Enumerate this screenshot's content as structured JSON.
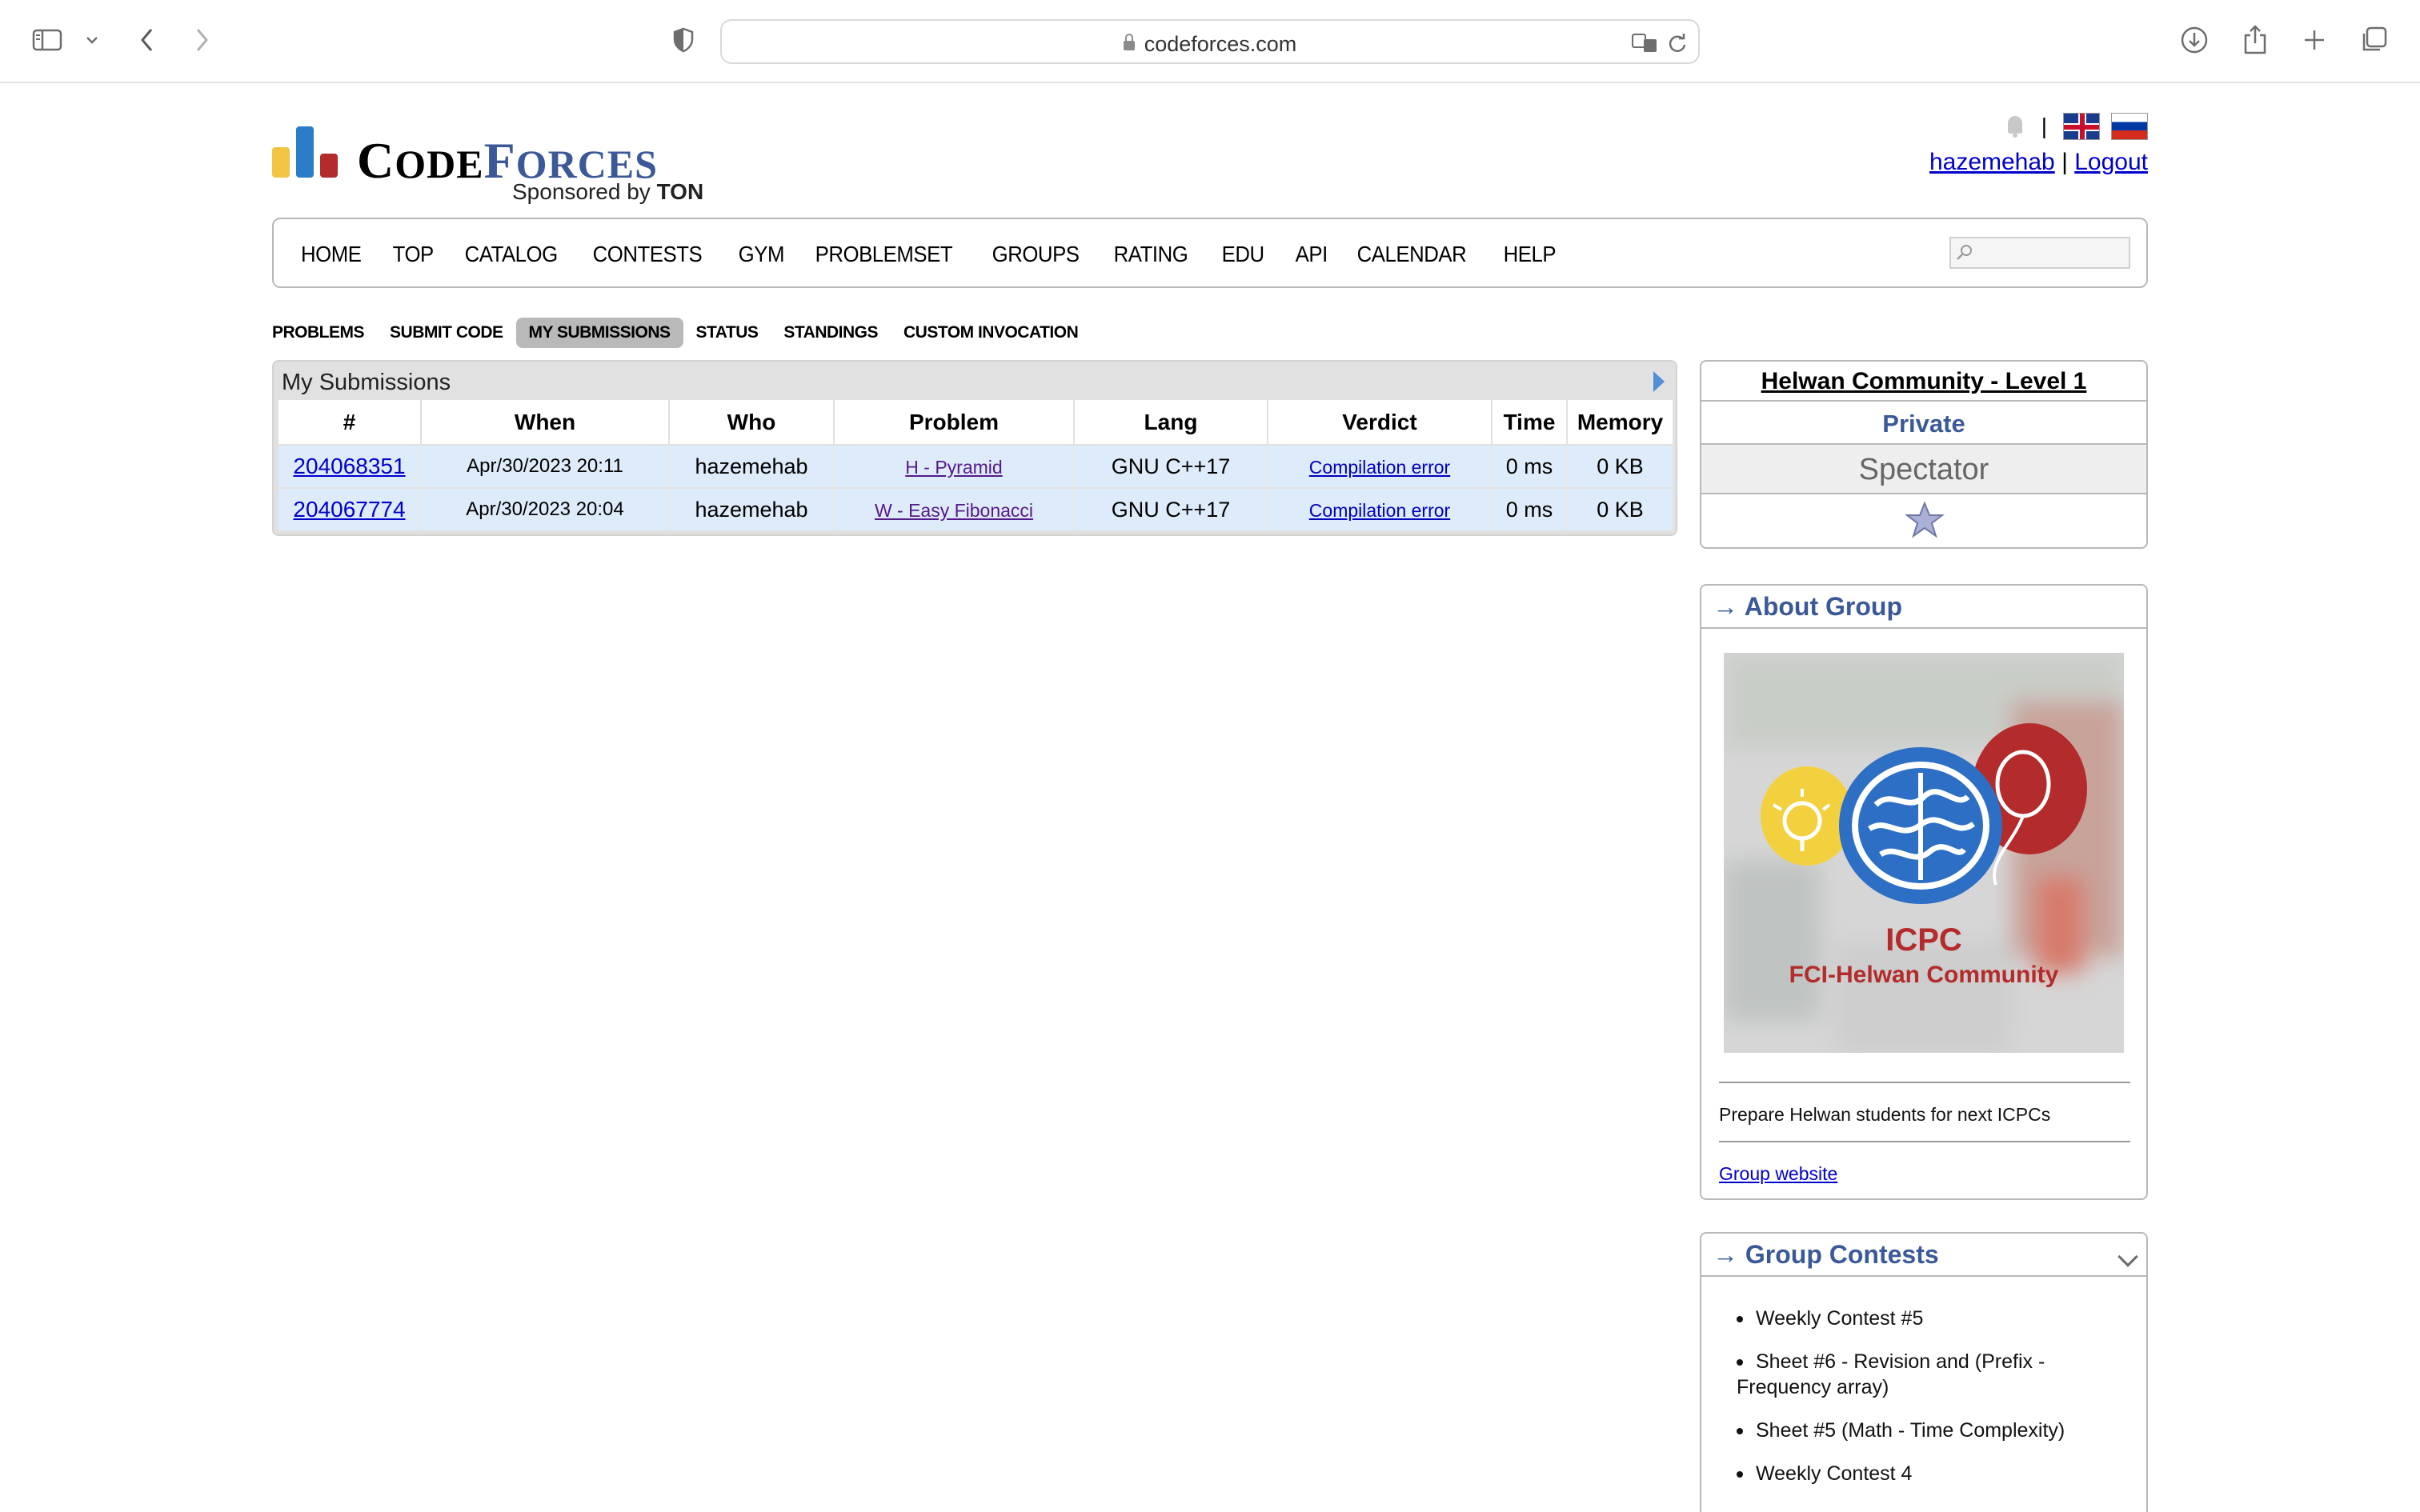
{
  "browser": {
    "url": "codeforces.com"
  },
  "header": {
    "logo": {
      "word_code": "C",
      "word_ode": "ODE",
      "word_f": "F",
      "word_orces": "ORCES",
      "sponsored_by": "Sponsored by",
      "sponsor": "TON"
    },
    "username": "hazemehab",
    "separator": "|",
    "logout": "Logout"
  },
  "main_menu": [
    "HOME",
    "TOP",
    "CATALOG",
    "CONTESTS",
    "GYM",
    "PROBLEMSET",
    "GROUPS",
    "RATING",
    "EDU",
    "API",
    "CALENDAR",
    "HELP"
  ],
  "second_menu": {
    "items": [
      "PROBLEMS",
      "SUBMIT CODE",
      "MY SUBMISSIONS",
      "STATUS",
      "STANDINGS",
      "CUSTOM INVOCATION"
    ],
    "active": "MY SUBMISSIONS"
  },
  "submissions": {
    "title": "My Submissions",
    "columns": [
      "#",
      "When",
      "Who",
      "Problem",
      "Lang",
      "Verdict",
      "Time",
      "Memory"
    ],
    "rows": [
      {
        "id": "204068351",
        "when": "Apr/30/2023 20:11",
        "who": "hazemehab",
        "problem": "H - Pyramid",
        "lang": "GNU C++17",
        "verdict": "Compilation error",
        "time": "0 ms",
        "memory": "0 KB"
      },
      {
        "id": "204067774",
        "when": "Apr/30/2023 20:04",
        "who": "hazemehab",
        "problem": "W - Easy Fibonacci",
        "lang": "GNU C++17",
        "verdict": "Compilation error",
        "time": "0 ms",
        "memory": "0 KB"
      }
    ]
  },
  "group": {
    "name": "Helwan Community - Level 1",
    "privacy": "Private",
    "role": "Spectator"
  },
  "about": {
    "title": "→ About Group",
    "image_text_1": "ICPC",
    "image_text_2": "FCI-Helwan Community",
    "description": "Prepare Helwan students for next ICPCs",
    "website_link": "Group website"
  },
  "contests": {
    "title": "→ Group Contests",
    "items": [
      "Weekly Contest #5",
      "Sheet #6 - Revision and (Prefix - Frequency array)",
      "Sheet #5 (Math - Time Complexity)",
      "Weekly Contest 4"
    ]
  },
  "colors": {
    "link": "#0000cc",
    "accent_blue": "#3b5998",
    "row_highlight": "#deebfa",
    "logo_yellow": "#f0c542",
    "logo_blue": "#2c7dc8",
    "logo_red": "#b32b2b"
  }
}
